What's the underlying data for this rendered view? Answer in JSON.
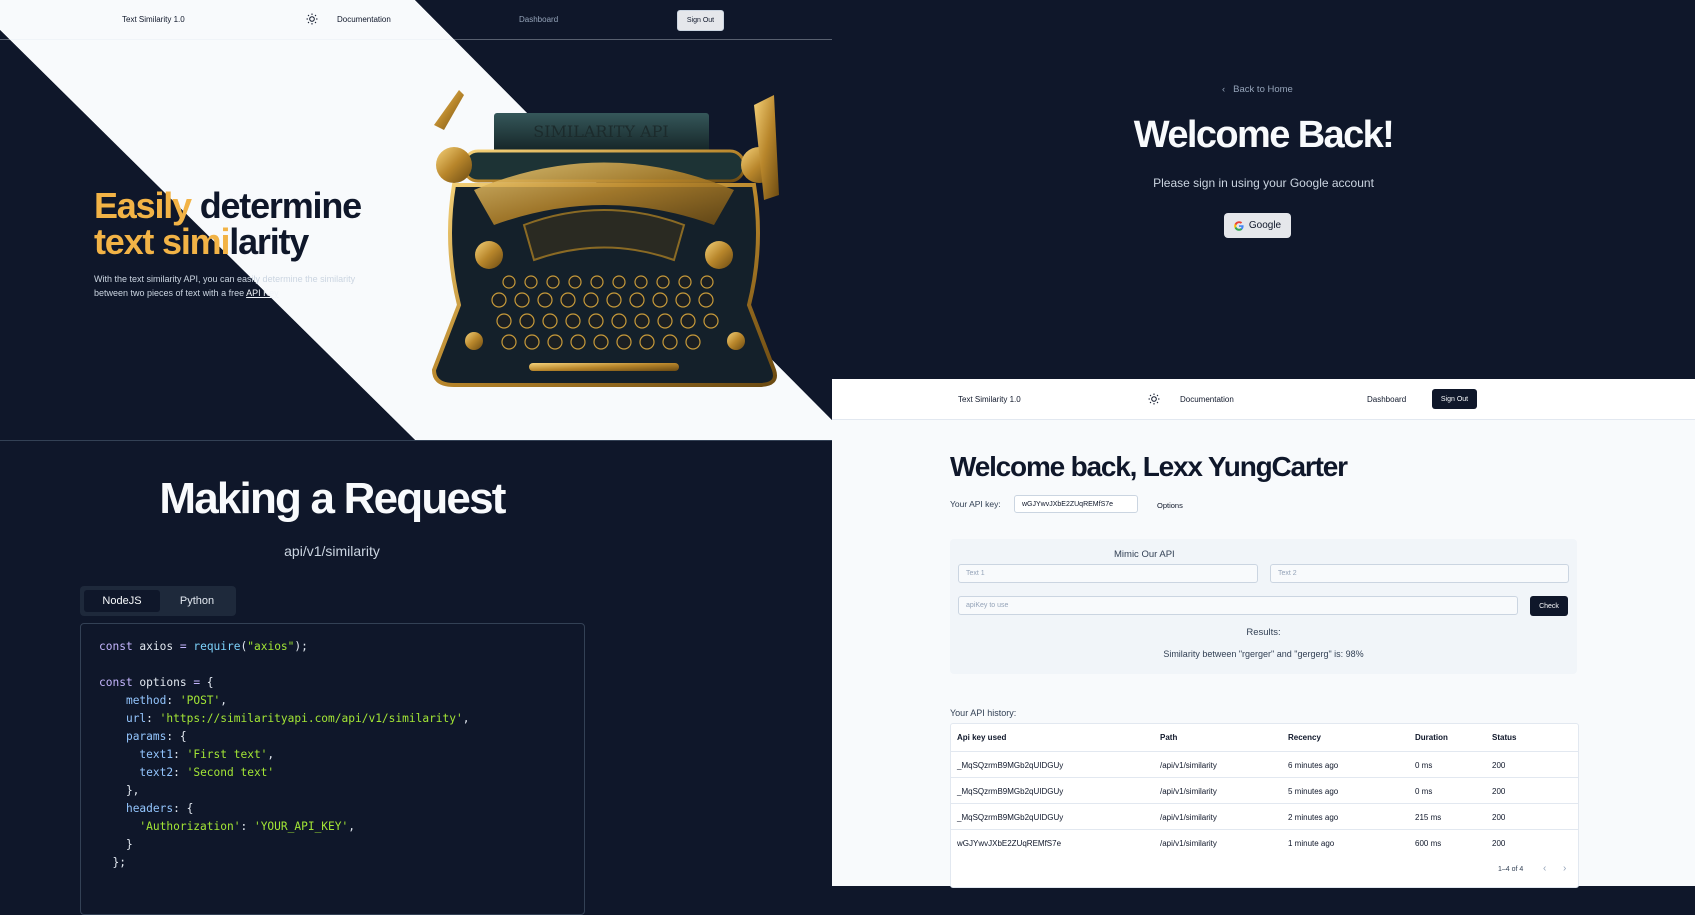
{
  "landing": {
    "nav": {
      "brand": "Text Similarity 1.0",
      "theme_icon": "sun-icon",
      "documentation": "Documentation",
      "dashboard": "Dashboard",
      "sign_out": "Sign Out"
    },
    "hero": {
      "title_highlight": "Easily",
      "title_rest_1": " determine",
      "title_highlight_2": "text simi",
      "title_rest_2": "larity",
      "description": "With the text similarity API, you can easily determine the similarity between two pieces of text with a free ",
      "api_key_link": "API Key",
      "image_text": "SIMILARITY API"
    }
  },
  "docs": {
    "title": "Making a Request",
    "path": "api/v1/similarity",
    "tabs": [
      "NodeJS",
      "Python"
    ],
    "active_tab": "NodeJS"
  },
  "login": {
    "back": "Back to Home",
    "title": "Welcome Back!",
    "subtitle": "Please sign in using your Google account",
    "google_button": "Google"
  },
  "dashboard": {
    "nav": {
      "brand": "Text Similarity 1.0",
      "documentation": "Documentation",
      "dashboard": "Dashboard",
      "sign_out": "Sign Out"
    },
    "title": "Welcome back, Lexx YungCarter",
    "api_key_label": "Your API key:",
    "api_key_value": "wGJYwvJXbE2ZUqREMfS7e",
    "options": "Options",
    "mimic": {
      "title": "Mimic Our API",
      "text1_placeholder": "Text 1",
      "text2_placeholder": "Text 2",
      "apikey_placeholder": "apiKey to use",
      "check": "Check",
      "results_label": "Results:",
      "results_text": "Similarity between \"rgerger\" and \"gergerg\" is: 98%"
    },
    "history_label": "Your API history:",
    "table": {
      "headers": [
        "Api key used",
        "Path",
        "Recency",
        "Duration",
        "Status"
      ],
      "rows": [
        [
          "_MqSQzrmB9MGb2qUIDGUy",
          "/api/v1/similarity",
          "6 minutes ago",
          "0 ms",
          "200"
        ],
        [
          "_MqSQzrmB9MGb2qUIDGUy",
          "/api/v1/similarity",
          "5 minutes ago",
          "0 ms",
          "200"
        ],
        [
          "_MqSQzrmB9MGb2qUIDGUy",
          "/api/v1/similarity",
          "2 minutes ago",
          "215 ms",
          "200"
        ],
        [
          "wGJYwvJXbE2ZUqREMfS7e",
          "/api/v1/similarity",
          "1 minute ago",
          "600 ms",
          "200"
        ]
      ],
      "pagination": "1–4 of 4"
    }
  },
  "colors": {
    "dark_bg": "#0f172a",
    "light_bg": "#f8fafc",
    "accent": "#f2b346"
  }
}
